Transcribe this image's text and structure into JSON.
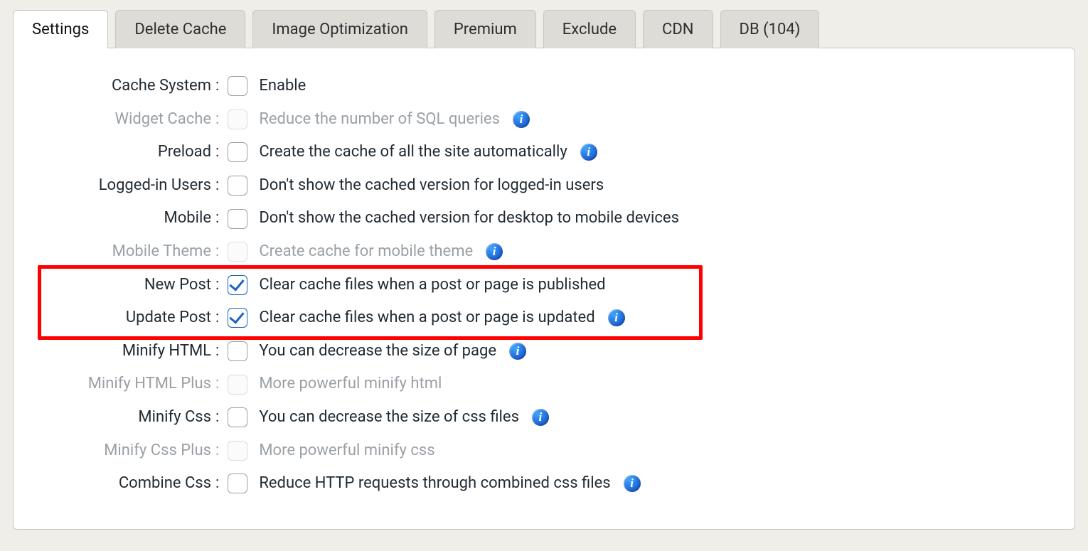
{
  "tabs": [
    {
      "label": "Settings",
      "active": true
    },
    {
      "label": "Delete Cache",
      "active": false
    },
    {
      "label": "Image Optimization",
      "active": false
    },
    {
      "label": "Premium",
      "active": false
    },
    {
      "label": "Exclude",
      "active": false
    },
    {
      "label": "CDN",
      "active": false
    },
    {
      "label": "DB (104)",
      "active": false
    }
  ],
  "rows": [
    {
      "key": "cache-system",
      "label": "Cache System",
      "desc": "Enable",
      "checked": false,
      "disabled": false,
      "info": false
    },
    {
      "key": "widget-cache",
      "label": "Widget Cache",
      "desc": "Reduce the number of SQL queries",
      "checked": false,
      "disabled": true,
      "info": true
    },
    {
      "key": "preload",
      "label": "Preload",
      "desc": "Create the cache of all the site automatically",
      "checked": false,
      "disabled": false,
      "info": true
    },
    {
      "key": "logged-in-users",
      "label": "Logged-in Users",
      "desc": "Don't show the cached version for logged-in users",
      "checked": false,
      "disabled": false,
      "info": false
    },
    {
      "key": "mobile",
      "label": "Mobile",
      "desc": "Don't show the cached version for desktop to mobile devices",
      "checked": false,
      "disabled": false,
      "info": false
    },
    {
      "key": "mobile-theme",
      "label": "Mobile Theme",
      "desc": "Create cache for mobile theme",
      "checked": false,
      "disabled": true,
      "info": true
    },
    {
      "key": "new-post",
      "label": "New Post",
      "desc": "Clear cache files when a post or page is published",
      "checked": true,
      "disabled": false,
      "info": false
    },
    {
      "key": "update-post",
      "label": "Update Post",
      "desc": "Clear cache files when a post or page is updated",
      "checked": true,
      "disabled": false,
      "info": true
    },
    {
      "key": "minify-html",
      "label": "Minify HTML",
      "desc": "You can decrease the size of page",
      "checked": false,
      "disabled": false,
      "info": true
    },
    {
      "key": "minify-html-plus",
      "label": "Minify HTML Plus",
      "desc": "More powerful minify html",
      "checked": false,
      "disabled": true,
      "info": false
    },
    {
      "key": "minify-css",
      "label": "Minify Css",
      "desc": "You can decrease the size of css files",
      "checked": false,
      "disabled": false,
      "info": true
    },
    {
      "key": "minify-css-plus",
      "label": "Minify Css Plus",
      "desc": "More powerful minify css",
      "checked": false,
      "disabled": true,
      "info": false
    },
    {
      "key": "combine-css",
      "label": "Combine Css",
      "desc": "Reduce HTTP requests through combined css files",
      "checked": false,
      "disabled": false,
      "info": true
    }
  ],
  "highlight": {
    "startKey": "new-post",
    "endKey": "update-post"
  },
  "info_glyph": "i"
}
